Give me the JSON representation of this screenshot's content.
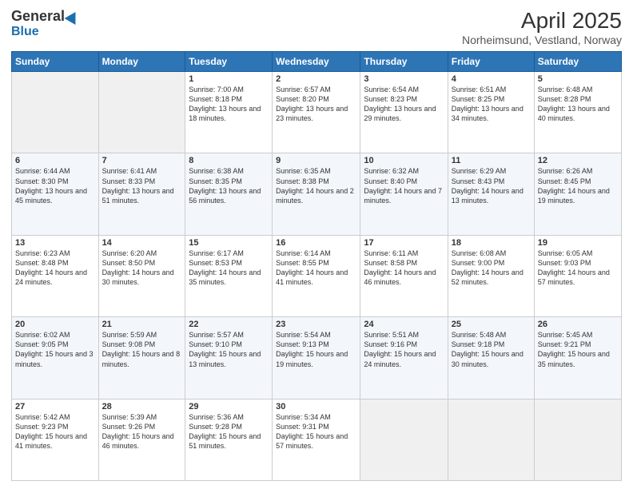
{
  "header": {
    "logo_general": "General",
    "logo_blue": "Blue",
    "title": "April 2025",
    "subtitle": "Norheimsund, Vestland, Norway"
  },
  "calendar": {
    "days_of_week": [
      "Sunday",
      "Monday",
      "Tuesday",
      "Wednesday",
      "Thursday",
      "Friday",
      "Saturday"
    ],
    "weeks": [
      [
        {
          "num": "",
          "detail": ""
        },
        {
          "num": "",
          "detail": ""
        },
        {
          "num": "1",
          "detail": "Sunrise: 7:00 AM\nSunset: 8:18 PM\nDaylight: 13 hours\nand 18 minutes."
        },
        {
          "num": "2",
          "detail": "Sunrise: 6:57 AM\nSunset: 8:20 PM\nDaylight: 13 hours\nand 23 minutes."
        },
        {
          "num": "3",
          "detail": "Sunrise: 6:54 AM\nSunset: 8:23 PM\nDaylight: 13 hours\nand 29 minutes."
        },
        {
          "num": "4",
          "detail": "Sunrise: 6:51 AM\nSunset: 8:25 PM\nDaylight: 13 hours\nand 34 minutes."
        },
        {
          "num": "5",
          "detail": "Sunrise: 6:48 AM\nSunset: 8:28 PM\nDaylight: 13 hours\nand 40 minutes."
        }
      ],
      [
        {
          "num": "6",
          "detail": "Sunrise: 6:44 AM\nSunset: 8:30 PM\nDaylight: 13 hours\nand 45 minutes."
        },
        {
          "num": "7",
          "detail": "Sunrise: 6:41 AM\nSunset: 8:33 PM\nDaylight: 13 hours\nand 51 minutes."
        },
        {
          "num": "8",
          "detail": "Sunrise: 6:38 AM\nSunset: 8:35 PM\nDaylight: 13 hours\nand 56 minutes."
        },
        {
          "num": "9",
          "detail": "Sunrise: 6:35 AM\nSunset: 8:38 PM\nDaylight: 14 hours\nand 2 minutes."
        },
        {
          "num": "10",
          "detail": "Sunrise: 6:32 AM\nSunset: 8:40 PM\nDaylight: 14 hours\nand 7 minutes."
        },
        {
          "num": "11",
          "detail": "Sunrise: 6:29 AM\nSunset: 8:43 PM\nDaylight: 14 hours\nand 13 minutes."
        },
        {
          "num": "12",
          "detail": "Sunrise: 6:26 AM\nSunset: 8:45 PM\nDaylight: 14 hours\nand 19 minutes."
        }
      ],
      [
        {
          "num": "13",
          "detail": "Sunrise: 6:23 AM\nSunset: 8:48 PM\nDaylight: 14 hours\nand 24 minutes."
        },
        {
          "num": "14",
          "detail": "Sunrise: 6:20 AM\nSunset: 8:50 PM\nDaylight: 14 hours\nand 30 minutes."
        },
        {
          "num": "15",
          "detail": "Sunrise: 6:17 AM\nSunset: 8:53 PM\nDaylight: 14 hours\nand 35 minutes."
        },
        {
          "num": "16",
          "detail": "Sunrise: 6:14 AM\nSunset: 8:55 PM\nDaylight: 14 hours\nand 41 minutes."
        },
        {
          "num": "17",
          "detail": "Sunrise: 6:11 AM\nSunset: 8:58 PM\nDaylight: 14 hours\nand 46 minutes."
        },
        {
          "num": "18",
          "detail": "Sunrise: 6:08 AM\nSunset: 9:00 PM\nDaylight: 14 hours\nand 52 minutes."
        },
        {
          "num": "19",
          "detail": "Sunrise: 6:05 AM\nSunset: 9:03 PM\nDaylight: 14 hours\nand 57 minutes."
        }
      ],
      [
        {
          "num": "20",
          "detail": "Sunrise: 6:02 AM\nSunset: 9:05 PM\nDaylight: 15 hours\nand 3 minutes."
        },
        {
          "num": "21",
          "detail": "Sunrise: 5:59 AM\nSunset: 9:08 PM\nDaylight: 15 hours\nand 8 minutes."
        },
        {
          "num": "22",
          "detail": "Sunrise: 5:57 AM\nSunset: 9:10 PM\nDaylight: 15 hours\nand 13 minutes."
        },
        {
          "num": "23",
          "detail": "Sunrise: 5:54 AM\nSunset: 9:13 PM\nDaylight: 15 hours\nand 19 minutes."
        },
        {
          "num": "24",
          "detail": "Sunrise: 5:51 AM\nSunset: 9:16 PM\nDaylight: 15 hours\nand 24 minutes."
        },
        {
          "num": "25",
          "detail": "Sunrise: 5:48 AM\nSunset: 9:18 PM\nDaylight: 15 hours\nand 30 minutes."
        },
        {
          "num": "26",
          "detail": "Sunrise: 5:45 AM\nSunset: 9:21 PM\nDaylight: 15 hours\nand 35 minutes."
        }
      ],
      [
        {
          "num": "27",
          "detail": "Sunrise: 5:42 AM\nSunset: 9:23 PM\nDaylight: 15 hours\nand 41 minutes."
        },
        {
          "num": "28",
          "detail": "Sunrise: 5:39 AM\nSunset: 9:26 PM\nDaylight: 15 hours\nand 46 minutes."
        },
        {
          "num": "29",
          "detail": "Sunrise: 5:36 AM\nSunset: 9:28 PM\nDaylight: 15 hours\nand 51 minutes."
        },
        {
          "num": "30",
          "detail": "Sunrise: 5:34 AM\nSunset: 9:31 PM\nDaylight: 15 hours\nand 57 minutes."
        },
        {
          "num": "",
          "detail": ""
        },
        {
          "num": "",
          "detail": ""
        },
        {
          "num": "",
          "detail": ""
        }
      ]
    ]
  }
}
